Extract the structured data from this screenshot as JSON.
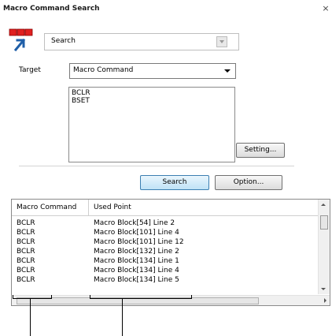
{
  "window": {
    "title": "Macro Command Search",
    "close_glyph": "×"
  },
  "icon": "macro-search-icon",
  "search_combo": {
    "value": "Search"
  },
  "target": {
    "label": "Target",
    "selected": "Macro Command"
  },
  "listbox": {
    "items": [
      "BCLR",
      "BSET"
    ]
  },
  "buttons": {
    "setting": "Setting...",
    "search": "Search",
    "option": "Option..."
  },
  "results": {
    "columns": [
      "Macro Command",
      "Used Point"
    ],
    "rows": [
      {
        "command": "BCLR",
        "used_point": "Macro Block[54] Line 2"
      },
      {
        "command": "BCLR",
        "used_point": "Macro Block[101] Line 4"
      },
      {
        "command": "BCLR",
        "used_point": "Macro Block[101] Line 12"
      },
      {
        "command": "BCLR",
        "used_point": "Macro Block[132] Line 2"
      },
      {
        "command": "BCLR",
        "used_point": "Macro Block[134] Line 1"
      },
      {
        "command": "BCLR",
        "used_point": "Macro Block[134] Line 4"
      },
      {
        "command": "BCLR",
        "used_point": "Macro Block[134] Line 5"
      }
    ]
  },
  "colors": {
    "search_button_border": "#3c7fb1",
    "icon_red": "#e02020",
    "icon_blue": "#1f5fa8"
  }
}
